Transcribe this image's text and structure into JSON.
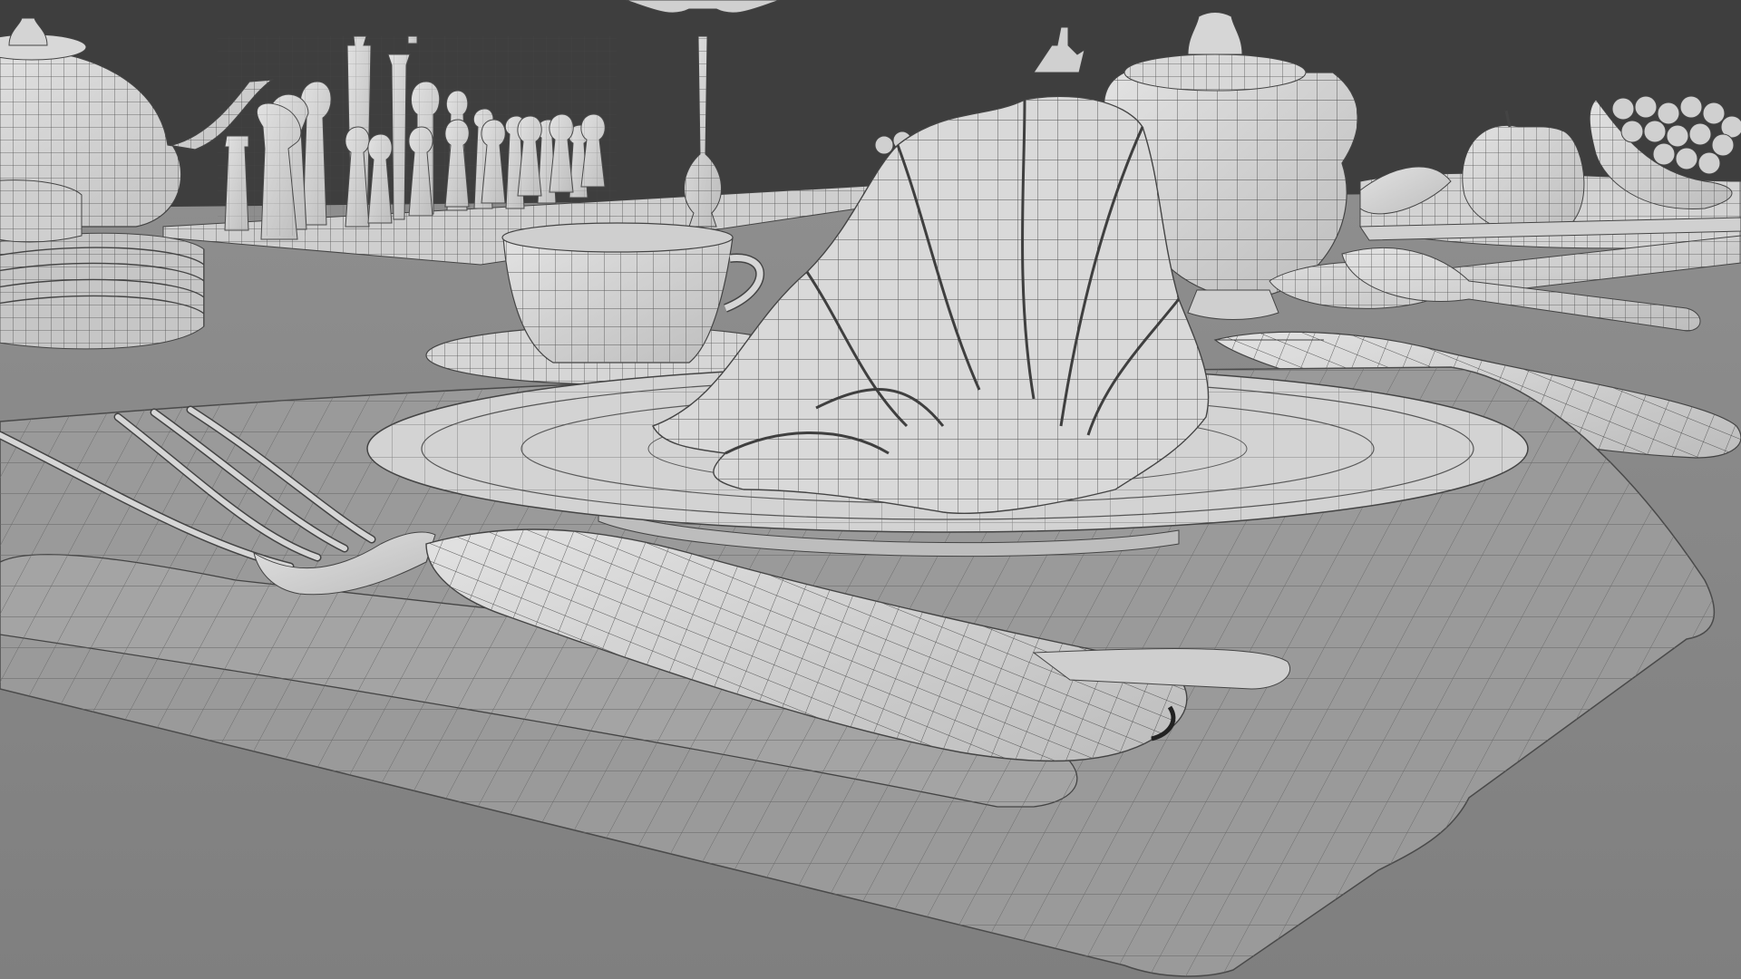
{
  "scene": {
    "kind": "3d-viewport-wireframe-render",
    "background_color": "#3e3e3e",
    "floor_color": "#8d8d8d",
    "mesh_color": "#d6d6d6",
    "wire_color": "#505050",
    "objects": [
      "teapot-left",
      "teapot-right",
      "chess-set",
      "candlestick",
      "plate-stack",
      "teacup",
      "saucer",
      "dinner-plate",
      "folded-napkin",
      "fork",
      "knife-foreground",
      "knife-right",
      "spoons",
      "placemat",
      "folded-cloth",
      "apple",
      "grapes",
      "banana",
      "fruit-plate"
    ]
  }
}
